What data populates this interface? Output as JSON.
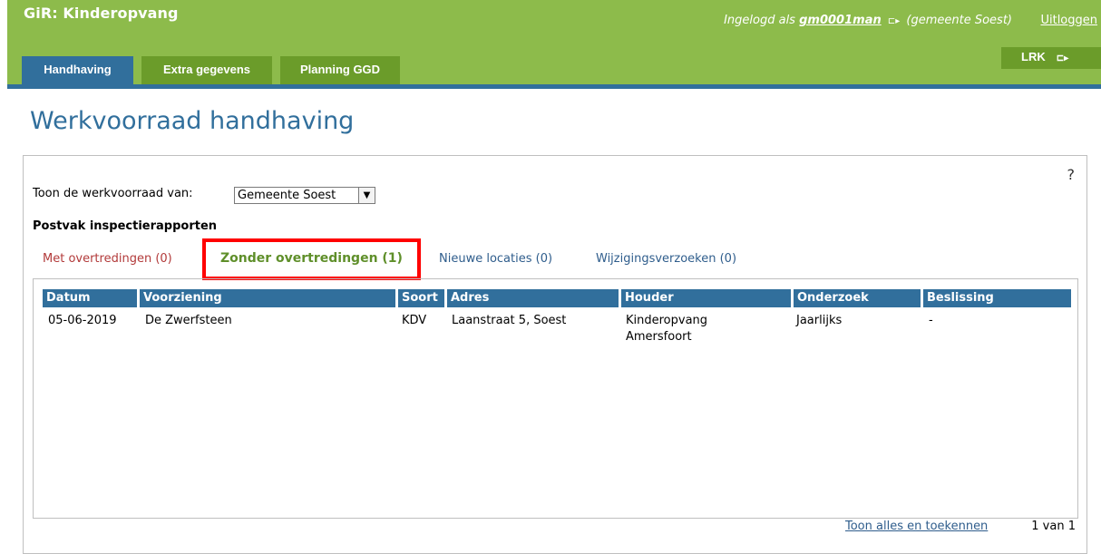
{
  "header": {
    "app_title": "GiR: Kinderopvang",
    "logged_in_prefix": "Ingelogd als",
    "username": "gm0001man",
    "municipality": "(gemeente Soest)",
    "logout_label": "Uitloggen",
    "lrk_label": "LRK",
    "external_icon": "⊏▸",
    "colors": {
      "header_bg": "#8dbb4b",
      "active_tab": "#316f9c",
      "inactive_tab": "#6b9c2a"
    }
  },
  "tabs": [
    {
      "label": "Handhaving",
      "active": true
    },
    {
      "label": "Extra gegevens",
      "active": false
    },
    {
      "label": "Planning GGD",
      "active": false
    }
  ],
  "page": {
    "title": "Werkvoorraad handhaving",
    "help_label": "?"
  },
  "filter": {
    "label": "Toon de werkvoorraad van:",
    "selected": "Gemeente Soest"
  },
  "section": {
    "title": "Postvak inspectierapporten"
  },
  "subtabs": [
    {
      "label": "Met overtredingen (0)"
    },
    {
      "label": "Zonder overtredingen (1)",
      "active": true
    },
    {
      "label": "Nieuwe locaties (0)"
    },
    {
      "label": "Wijzigingsverzoeken (0)"
    }
  ],
  "table": {
    "columns": [
      "Datum",
      "Voorziening",
      "Soort",
      "Adres",
      "Houder",
      "Onderzoek",
      "Beslissing"
    ],
    "rows": [
      {
        "datum": "05-06-2019",
        "voorziening": "De Zwerfsteen",
        "soort": "KDV",
        "adres": "Laanstraat 5, Soest",
        "houder_line1": "Kinderopvang",
        "houder_line2": "Amersfoort",
        "onderzoek": "Jaarlijks",
        "beslissing": "-"
      }
    ]
  },
  "footer": {
    "link_label": "Toon alles en toekennen",
    "pager": "1 van 1"
  }
}
